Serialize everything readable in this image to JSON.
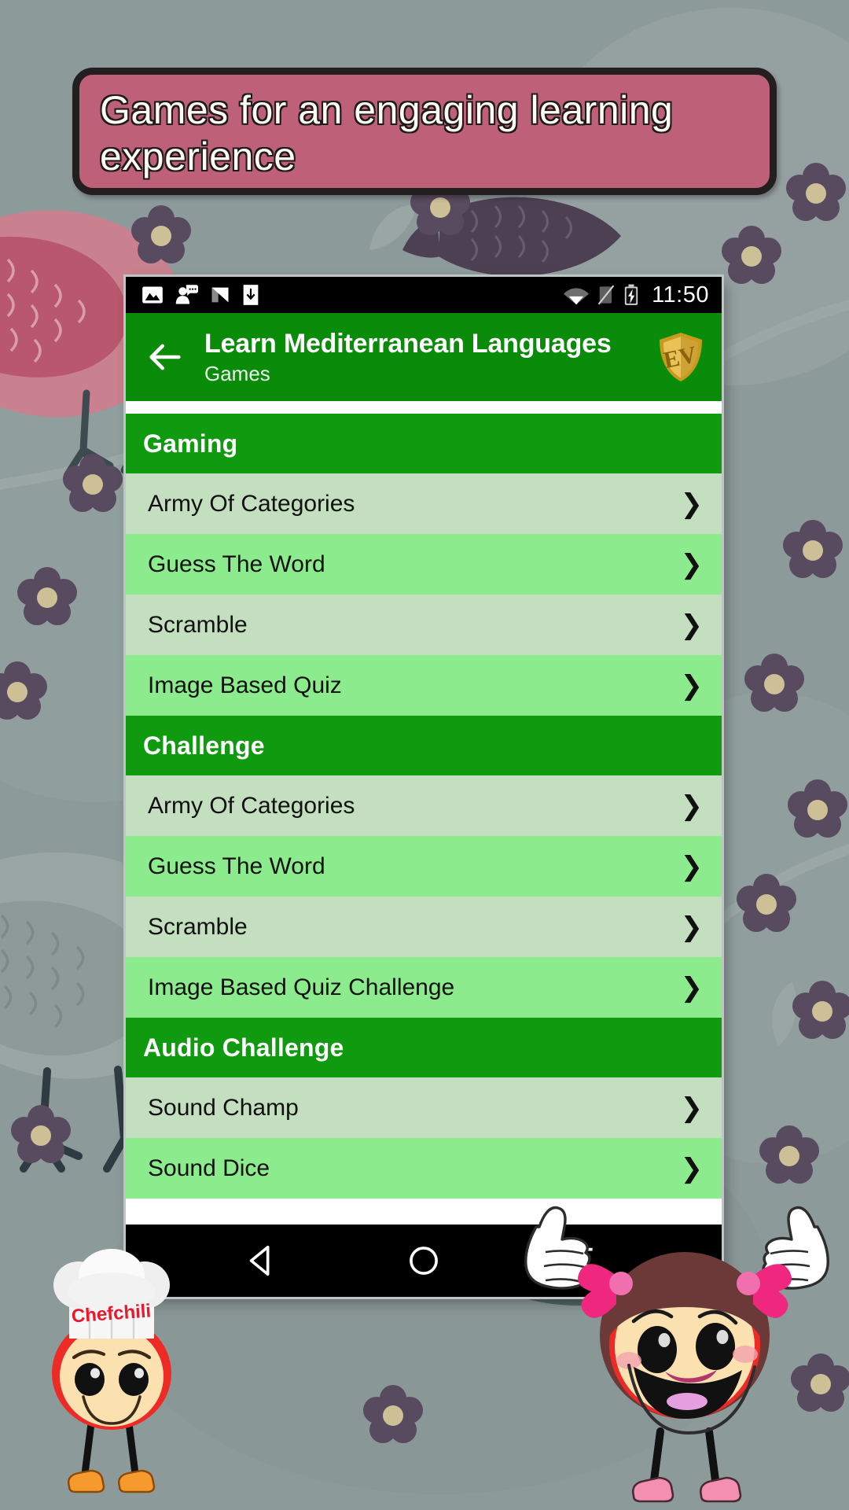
{
  "promo": {
    "text": "Games for an engaging learning experience",
    "bg_color": "#bd6078",
    "border_color": "#231f20",
    "text_color": "#fdfaf2"
  },
  "status_bar": {
    "time": "11:50",
    "left_icons": [
      "image-icon",
      "speech-person-icon",
      "nova-launcher-icon",
      "download-icon"
    ],
    "right_icons": [
      "wifi-icon",
      "signal-off-icon",
      "battery-charging-icon"
    ],
    "bg_color": "#000000"
  },
  "app_bar": {
    "back_icon": "back-arrow-icon",
    "title": "Learn Mediterranean Languages",
    "subtitle": "Games",
    "logo_text": "EV",
    "bg_color": "#0a8c0a",
    "logo_color": "#d4a017"
  },
  "list": {
    "chevron": "❯",
    "section_bg": "#109a10",
    "row_bg_odd": "#c4dfc0",
    "row_bg_even": "#8ceb8c",
    "sections": [
      {
        "title": "Gaming",
        "items": [
          {
            "label": "Army Of Categories"
          },
          {
            "label": "Guess The Word"
          },
          {
            "label": "Scramble"
          },
          {
            "label": "Image Based Quiz"
          }
        ]
      },
      {
        "title": "Challenge",
        "items": [
          {
            "label": "Army Of Categories"
          },
          {
            "label": "Guess The Word"
          },
          {
            "label": "Scramble"
          },
          {
            "label": "Image Based Quiz Challenge"
          }
        ]
      },
      {
        "title": "Audio Challenge",
        "items": [
          {
            "label": "Sound Champ"
          },
          {
            "label": "Sound Dice"
          }
        ]
      }
    ]
  },
  "nav_bar": {
    "buttons": [
      "back-triangle-icon",
      "home-circle-icon",
      "recents-square-icon"
    ],
    "bg_color": "#000000"
  },
  "mascots": {
    "chef": {
      "name": "chefchili-mascot",
      "hat_text": "Chefchili",
      "hat_text_color": "#e8192c"
    },
    "girl": {
      "name": "girl-thumbs-up-mascot"
    }
  },
  "background": {
    "base_color": "#8d9a9a",
    "bird_color": "#c77f8e",
    "flower_color": "#5a4b60"
  }
}
